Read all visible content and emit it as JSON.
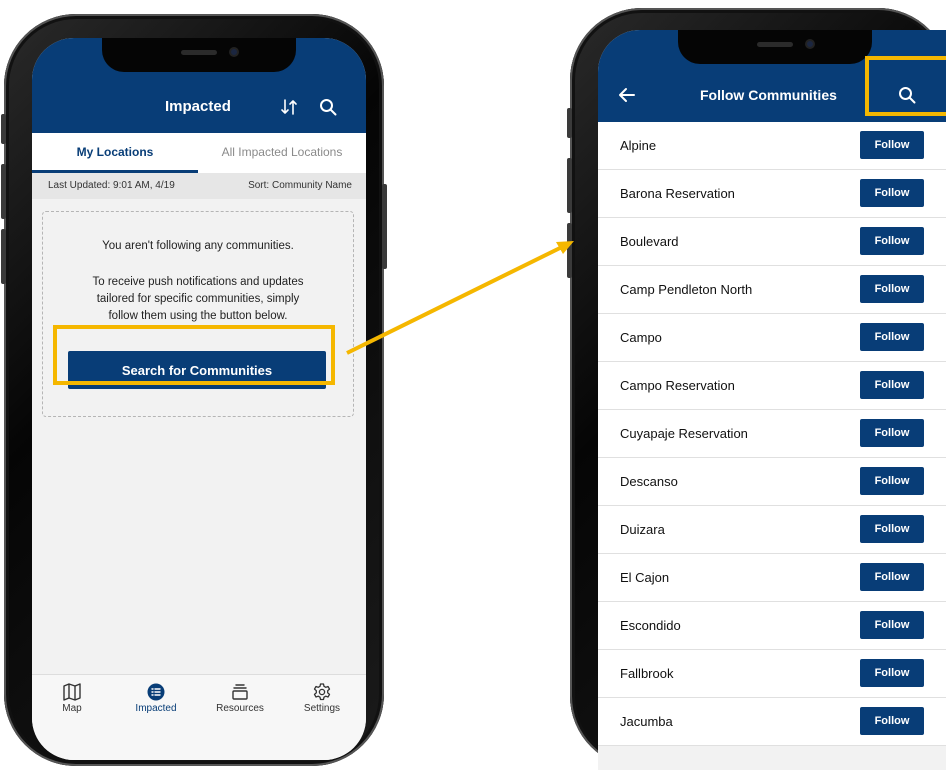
{
  "colors": {
    "brand": "#083d77",
    "highlight": "#f5b700",
    "background": "#f2f2f2"
  },
  "left_screen": {
    "header": {
      "title": "Impacted",
      "sort_icon": "sort-arrows-icon",
      "search_icon": "search-icon"
    },
    "tabs": [
      {
        "label": "My Locations",
        "active": true
      },
      {
        "label": "All Impacted Locations",
        "active": false
      }
    ],
    "meta": {
      "last_updated": "Last Updated: 9:01 AM, 4/19",
      "sort": "Sort: Community Name"
    },
    "empty_state": {
      "line1": "You aren't following any communities.",
      "line2": "To receive push notifications and updates",
      "line3": "tailored for specific communities, simply",
      "line4": "follow them using the button below.",
      "button": "Search for Communities"
    },
    "bottom_nav": [
      {
        "label": "Map",
        "icon": "map-icon",
        "active": false
      },
      {
        "label": "Impacted",
        "icon": "list-icon",
        "active": true
      },
      {
        "label": "Resources",
        "icon": "resources-icon",
        "active": false
      },
      {
        "label": "Settings",
        "icon": "gear-icon",
        "active": false
      }
    ]
  },
  "right_screen": {
    "header": {
      "title": "Follow Communities",
      "back_icon": "back-arrow-icon",
      "search_icon": "search-icon"
    },
    "follow_label": "Follow",
    "communities": [
      "Alpine",
      "Barona Reservation",
      "Boulevard",
      "Camp Pendleton North",
      "Campo",
      "Campo Reservation",
      "Cuyapaje Reservation",
      "Descanso",
      "Duizara",
      "El Cajon",
      "Escondido",
      "Fallbrook",
      "Jacumba"
    ]
  }
}
